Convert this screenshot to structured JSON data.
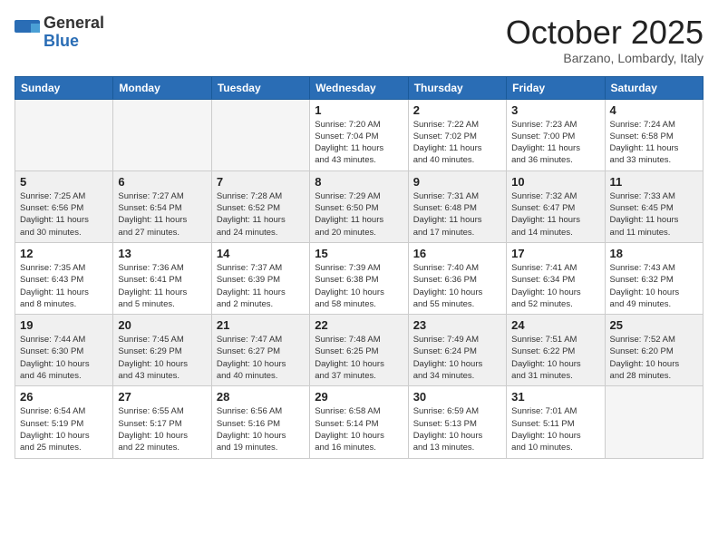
{
  "header": {
    "logo_general": "General",
    "logo_blue": "Blue",
    "month_title": "October 2025",
    "location": "Barzano, Lombardy, Italy"
  },
  "days_of_week": [
    "Sunday",
    "Monday",
    "Tuesday",
    "Wednesday",
    "Thursday",
    "Friday",
    "Saturday"
  ],
  "weeks": [
    [
      {
        "day": "",
        "info": ""
      },
      {
        "day": "",
        "info": ""
      },
      {
        "day": "",
        "info": ""
      },
      {
        "day": "1",
        "info": "Sunrise: 7:20 AM\nSunset: 7:04 PM\nDaylight: 11 hours\nand 43 minutes."
      },
      {
        "day": "2",
        "info": "Sunrise: 7:22 AM\nSunset: 7:02 PM\nDaylight: 11 hours\nand 40 minutes."
      },
      {
        "day": "3",
        "info": "Sunrise: 7:23 AM\nSunset: 7:00 PM\nDaylight: 11 hours\nand 36 minutes."
      },
      {
        "day": "4",
        "info": "Sunrise: 7:24 AM\nSunset: 6:58 PM\nDaylight: 11 hours\nand 33 minutes."
      }
    ],
    [
      {
        "day": "5",
        "info": "Sunrise: 7:25 AM\nSunset: 6:56 PM\nDaylight: 11 hours\nand 30 minutes."
      },
      {
        "day": "6",
        "info": "Sunrise: 7:27 AM\nSunset: 6:54 PM\nDaylight: 11 hours\nand 27 minutes."
      },
      {
        "day": "7",
        "info": "Sunrise: 7:28 AM\nSunset: 6:52 PM\nDaylight: 11 hours\nand 24 minutes."
      },
      {
        "day": "8",
        "info": "Sunrise: 7:29 AM\nSunset: 6:50 PM\nDaylight: 11 hours\nand 20 minutes."
      },
      {
        "day": "9",
        "info": "Sunrise: 7:31 AM\nSunset: 6:48 PM\nDaylight: 11 hours\nand 17 minutes."
      },
      {
        "day": "10",
        "info": "Sunrise: 7:32 AM\nSunset: 6:47 PM\nDaylight: 11 hours\nand 14 minutes."
      },
      {
        "day": "11",
        "info": "Sunrise: 7:33 AM\nSunset: 6:45 PM\nDaylight: 11 hours\nand 11 minutes."
      }
    ],
    [
      {
        "day": "12",
        "info": "Sunrise: 7:35 AM\nSunset: 6:43 PM\nDaylight: 11 hours\nand 8 minutes."
      },
      {
        "day": "13",
        "info": "Sunrise: 7:36 AM\nSunset: 6:41 PM\nDaylight: 11 hours\nand 5 minutes."
      },
      {
        "day": "14",
        "info": "Sunrise: 7:37 AM\nSunset: 6:39 PM\nDaylight: 11 hours\nand 2 minutes."
      },
      {
        "day": "15",
        "info": "Sunrise: 7:39 AM\nSunset: 6:38 PM\nDaylight: 10 hours\nand 58 minutes."
      },
      {
        "day": "16",
        "info": "Sunrise: 7:40 AM\nSunset: 6:36 PM\nDaylight: 10 hours\nand 55 minutes."
      },
      {
        "day": "17",
        "info": "Sunrise: 7:41 AM\nSunset: 6:34 PM\nDaylight: 10 hours\nand 52 minutes."
      },
      {
        "day": "18",
        "info": "Sunrise: 7:43 AM\nSunset: 6:32 PM\nDaylight: 10 hours\nand 49 minutes."
      }
    ],
    [
      {
        "day": "19",
        "info": "Sunrise: 7:44 AM\nSunset: 6:30 PM\nDaylight: 10 hours\nand 46 minutes."
      },
      {
        "day": "20",
        "info": "Sunrise: 7:45 AM\nSunset: 6:29 PM\nDaylight: 10 hours\nand 43 minutes."
      },
      {
        "day": "21",
        "info": "Sunrise: 7:47 AM\nSunset: 6:27 PM\nDaylight: 10 hours\nand 40 minutes."
      },
      {
        "day": "22",
        "info": "Sunrise: 7:48 AM\nSunset: 6:25 PM\nDaylight: 10 hours\nand 37 minutes."
      },
      {
        "day": "23",
        "info": "Sunrise: 7:49 AM\nSunset: 6:24 PM\nDaylight: 10 hours\nand 34 minutes."
      },
      {
        "day": "24",
        "info": "Sunrise: 7:51 AM\nSunset: 6:22 PM\nDaylight: 10 hours\nand 31 minutes."
      },
      {
        "day": "25",
        "info": "Sunrise: 7:52 AM\nSunset: 6:20 PM\nDaylight: 10 hours\nand 28 minutes."
      }
    ],
    [
      {
        "day": "26",
        "info": "Sunrise: 6:54 AM\nSunset: 5:19 PM\nDaylight: 10 hours\nand 25 minutes."
      },
      {
        "day": "27",
        "info": "Sunrise: 6:55 AM\nSunset: 5:17 PM\nDaylight: 10 hours\nand 22 minutes."
      },
      {
        "day": "28",
        "info": "Sunrise: 6:56 AM\nSunset: 5:16 PM\nDaylight: 10 hours\nand 19 minutes."
      },
      {
        "day": "29",
        "info": "Sunrise: 6:58 AM\nSunset: 5:14 PM\nDaylight: 10 hours\nand 16 minutes."
      },
      {
        "day": "30",
        "info": "Sunrise: 6:59 AM\nSunset: 5:13 PM\nDaylight: 10 hours\nand 13 minutes."
      },
      {
        "day": "31",
        "info": "Sunrise: 7:01 AM\nSunset: 5:11 PM\nDaylight: 10 hours\nand 10 minutes."
      },
      {
        "day": "",
        "info": ""
      }
    ]
  ]
}
